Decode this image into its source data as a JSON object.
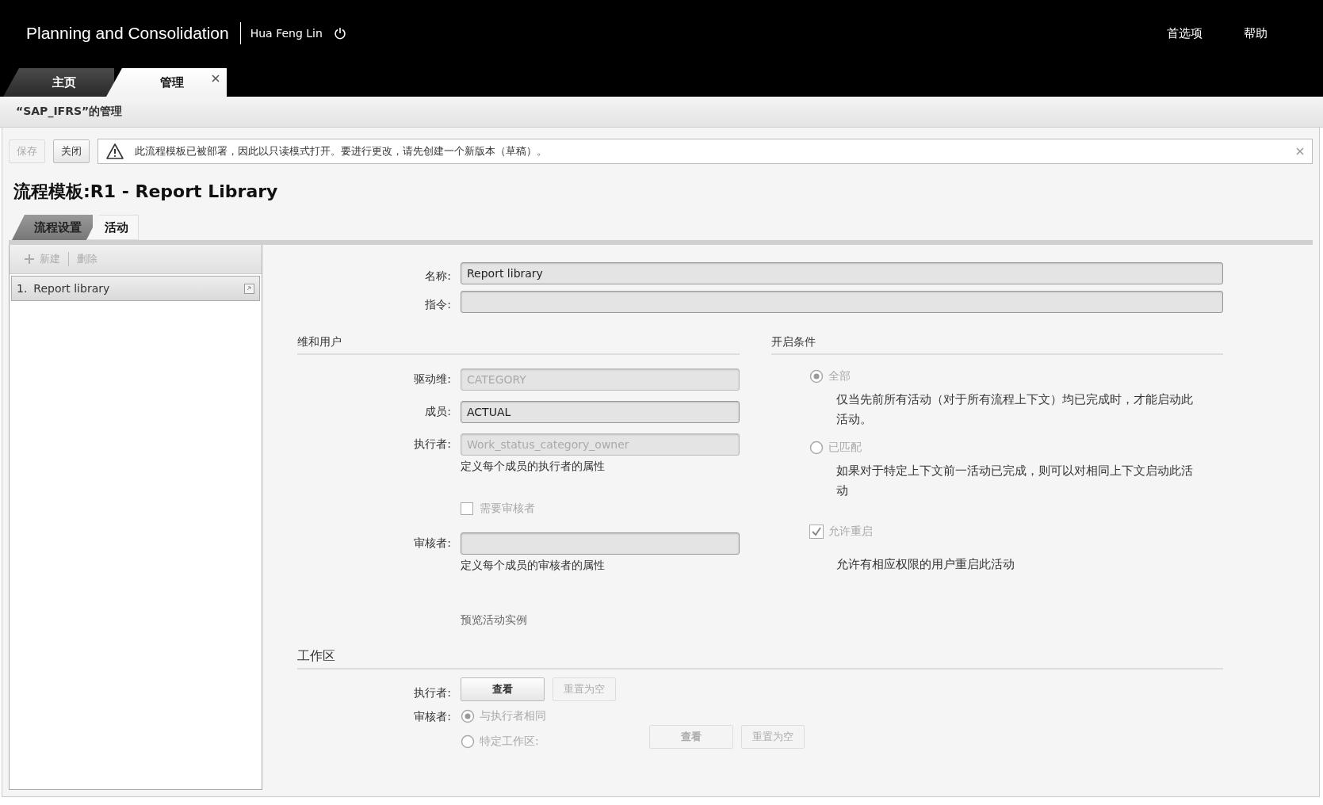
{
  "app": {
    "title": "Planning and Consolidation",
    "user": "Hua Feng Lin",
    "links": [
      "首选项",
      "帮助"
    ]
  },
  "tabs": [
    {
      "label": "主页",
      "selected": false,
      "closable": false
    },
    {
      "label": "管理",
      "selected": true,
      "closable": true
    }
  ],
  "breadcrumb": "“SAP_IFRS”的管理",
  "toolbar": {
    "buttons": [
      {
        "label": "保存",
        "disabled": true
      },
      {
        "label": "关闭",
        "disabled": false
      }
    ],
    "message": "此流程模板已被部署，因此以只读模式打开。要进行更改，请先创建一个新版本（草稿）。"
  },
  "title": "流程模板:R1 - Report Library",
  "subtabs": [
    {
      "label": "流程设置",
      "selected": false
    },
    {
      "label": "活动",
      "selected": true
    }
  ],
  "activity_list": {
    "actions": [
      {
        "label": "新建",
        "disabled": true,
        "kind": "add"
      },
      {
        "label": "删除",
        "disabled": true,
        "kind": "plain"
      }
    ],
    "items": [
      {
        "number": "1.",
        "label": "Report library",
        "selected": true
      }
    ]
  },
  "fields": [
    {
      "label": "名称:",
      "value": "Report library"
    },
    {
      "label": "指令:"
    }
  ],
  "dimension_users": {
    "heading": "维和用户",
    "rows": [
      {
        "kind": "field",
        "label": "驱动维:",
        "value": "CATEGORY",
        "disabled": true
      },
      {
        "kind": "field",
        "label": "成员:",
        "value": "ACTUAL",
        "disabled": false
      },
      {
        "kind": "field",
        "label": "执行者:",
        "value": "Work_status_category_owner",
        "disabled": true,
        "hint": "定义每个成员的执行者的属性"
      },
      {
        "kind": "checkbox",
        "label": "需要审核者",
        "checked": false
      },
      {
        "kind": "field",
        "label": "审核者:",
        "disabled": false,
        "hint": "定义每个成员的审核者的属性"
      },
      {
        "kind": "link",
        "label": "预览活动实例"
      }
    ]
  },
  "start_conditions": {
    "heading": "开启条件",
    "options": [
      {
        "label": "全部",
        "selected": true,
        "description": "仅当先前所有活动（对于所有流程上下文）均已完成时，才能启动此活动。"
      },
      {
        "label": "已匹配",
        "selected": false,
        "description": "如果对于特定上下文前一活动已完成，则可以对相同上下文启动此活动"
      }
    ],
    "restart": {
      "label": "允许重启",
      "checked": true,
      "description": "允许有相应权限的用户重启此活动"
    }
  },
  "workspace": {
    "heading": "工作区",
    "executor": {
      "label": "执行者:",
      "buttons": [
        {
          "label": "查看",
          "disabled": false
        },
        {
          "label": "重置为空",
          "disabled": true
        }
      ]
    },
    "reviewer": {
      "label": "审核者:",
      "options": [
        {
          "label": "与执行者相同",
          "selected": true
        },
        {
          "label": "特定工作区:",
          "selected": false
        }
      ],
      "buttons": [
        {
          "label": "查看",
          "disabled": true
        },
        {
          "label": "重置为空",
          "disabled": true
        }
      ]
    }
  }
}
